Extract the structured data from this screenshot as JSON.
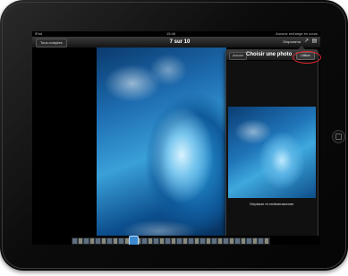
{
  "status_bar": {
    "left": "iPad",
    "time": "15:46",
    "right": "Aucune recharge en cours"
  },
  "nav_bar": {
    "back_label": "Tous comptes",
    "title": "7 sur 10",
    "right_label": "Diaporama",
    "icons": [
      "share-icon",
      "trash-icon"
    ]
  },
  "popover": {
    "cancel_label": "Annuler",
    "title": "Choisir une photo",
    "use_label": "Utiliser",
    "caption": "Déplacer et redimensionner"
  },
  "colors": {
    "highlight": "#e0282e",
    "scrubber_selected": "#3b8ad0"
  }
}
